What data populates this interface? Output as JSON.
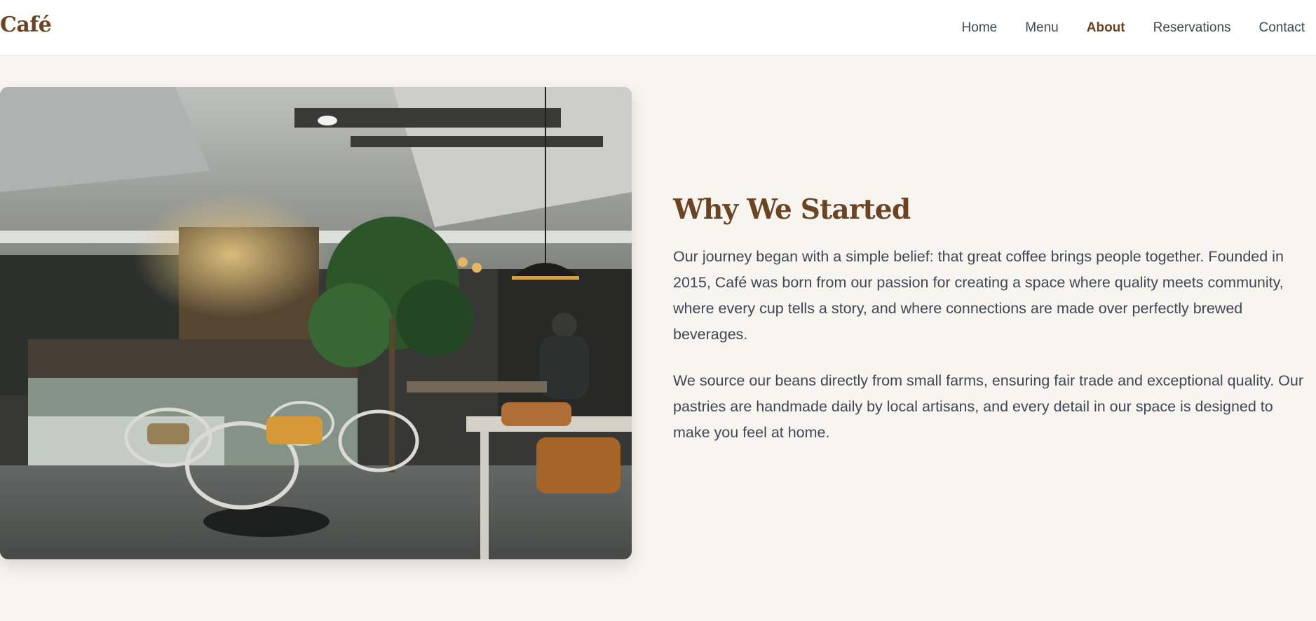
{
  "header": {
    "logo": "Café",
    "nav": [
      {
        "label": "Home",
        "active": false
      },
      {
        "label": "Menu",
        "active": false
      },
      {
        "label": "About",
        "active": true
      },
      {
        "label": "Reservations",
        "active": false
      },
      {
        "label": "Contact",
        "active": false
      }
    ]
  },
  "about": {
    "title": "Why We Started",
    "paragraphs": [
      "Our journey began with a simple belief: that great coffee brings people together. Founded in 2015, Café was born from our passion for creating a space where quality meets community, where every cup tells a story, and where connections are made over perfectly brewed beverages.",
      "We source our beans directly from small farms, ensuring fair trade and exceptional quality. Our pastries are handmade daily by local artisans, and every detail in our space is designed to make you feel at home."
    ]
  },
  "colors": {
    "brand": "#6b4423",
    "text": "#3f4654",
    "background": "#f8f5f0"
  }
}
